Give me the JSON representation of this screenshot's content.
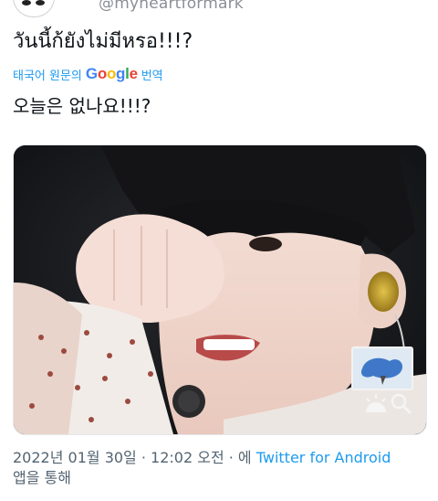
{
  "header": {
    "handle": "@myheartformark"
  },
  "tweet": {
    "text": "วันนี้ก้ยังไม่มีหรอ!!!?",
    "translate_prefix": "태국어 원문의",
    "translate_brand": "Google",
    "translate_suffix": "번역",
    "translated_text": "오늘은 없나요!!!?"
  },
  "media": {
    "icons": [
      "thumbnail-preview-icon",
      "brightness-icon",
      "zoom-icon"
    ]
  },
  "meta": {
    "timestamp": "2022년 01월 30일 · 12:02 오전",
    "via_prefix": " · 에 ",
    "client": "Twitter for Android",
    "via_suffix": "앱을 통해"
  },
  "colors": {
    "link": "#1d9bf0",
    "muted": "#536471",
    "text": "#0f1419"
  }
}
